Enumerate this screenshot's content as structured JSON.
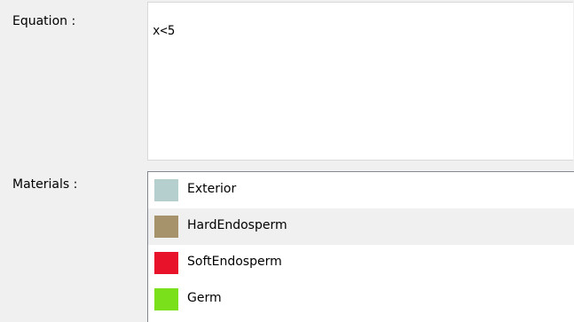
{
  "labels": {
    "equation": "Equation :",
    "materials": "Materials :"
  },
  "equation": {
    "value": "x<5"
  },
  "materials": [
    {
      "name": "Exterior",
      "color": "#b4cfcd",
      "selected": false
    },
    {
      "name": "HardEndosperm",
      "color": "#a6936b",
      "selected": true
    },
    {
      "name": "SoftEndosperm",
      "color": "#e8122a",
      "selected": false
    },
    {
      "name": "Germ",
      "color": "#7be01c",
      "selected": false
    }
  ]
}
